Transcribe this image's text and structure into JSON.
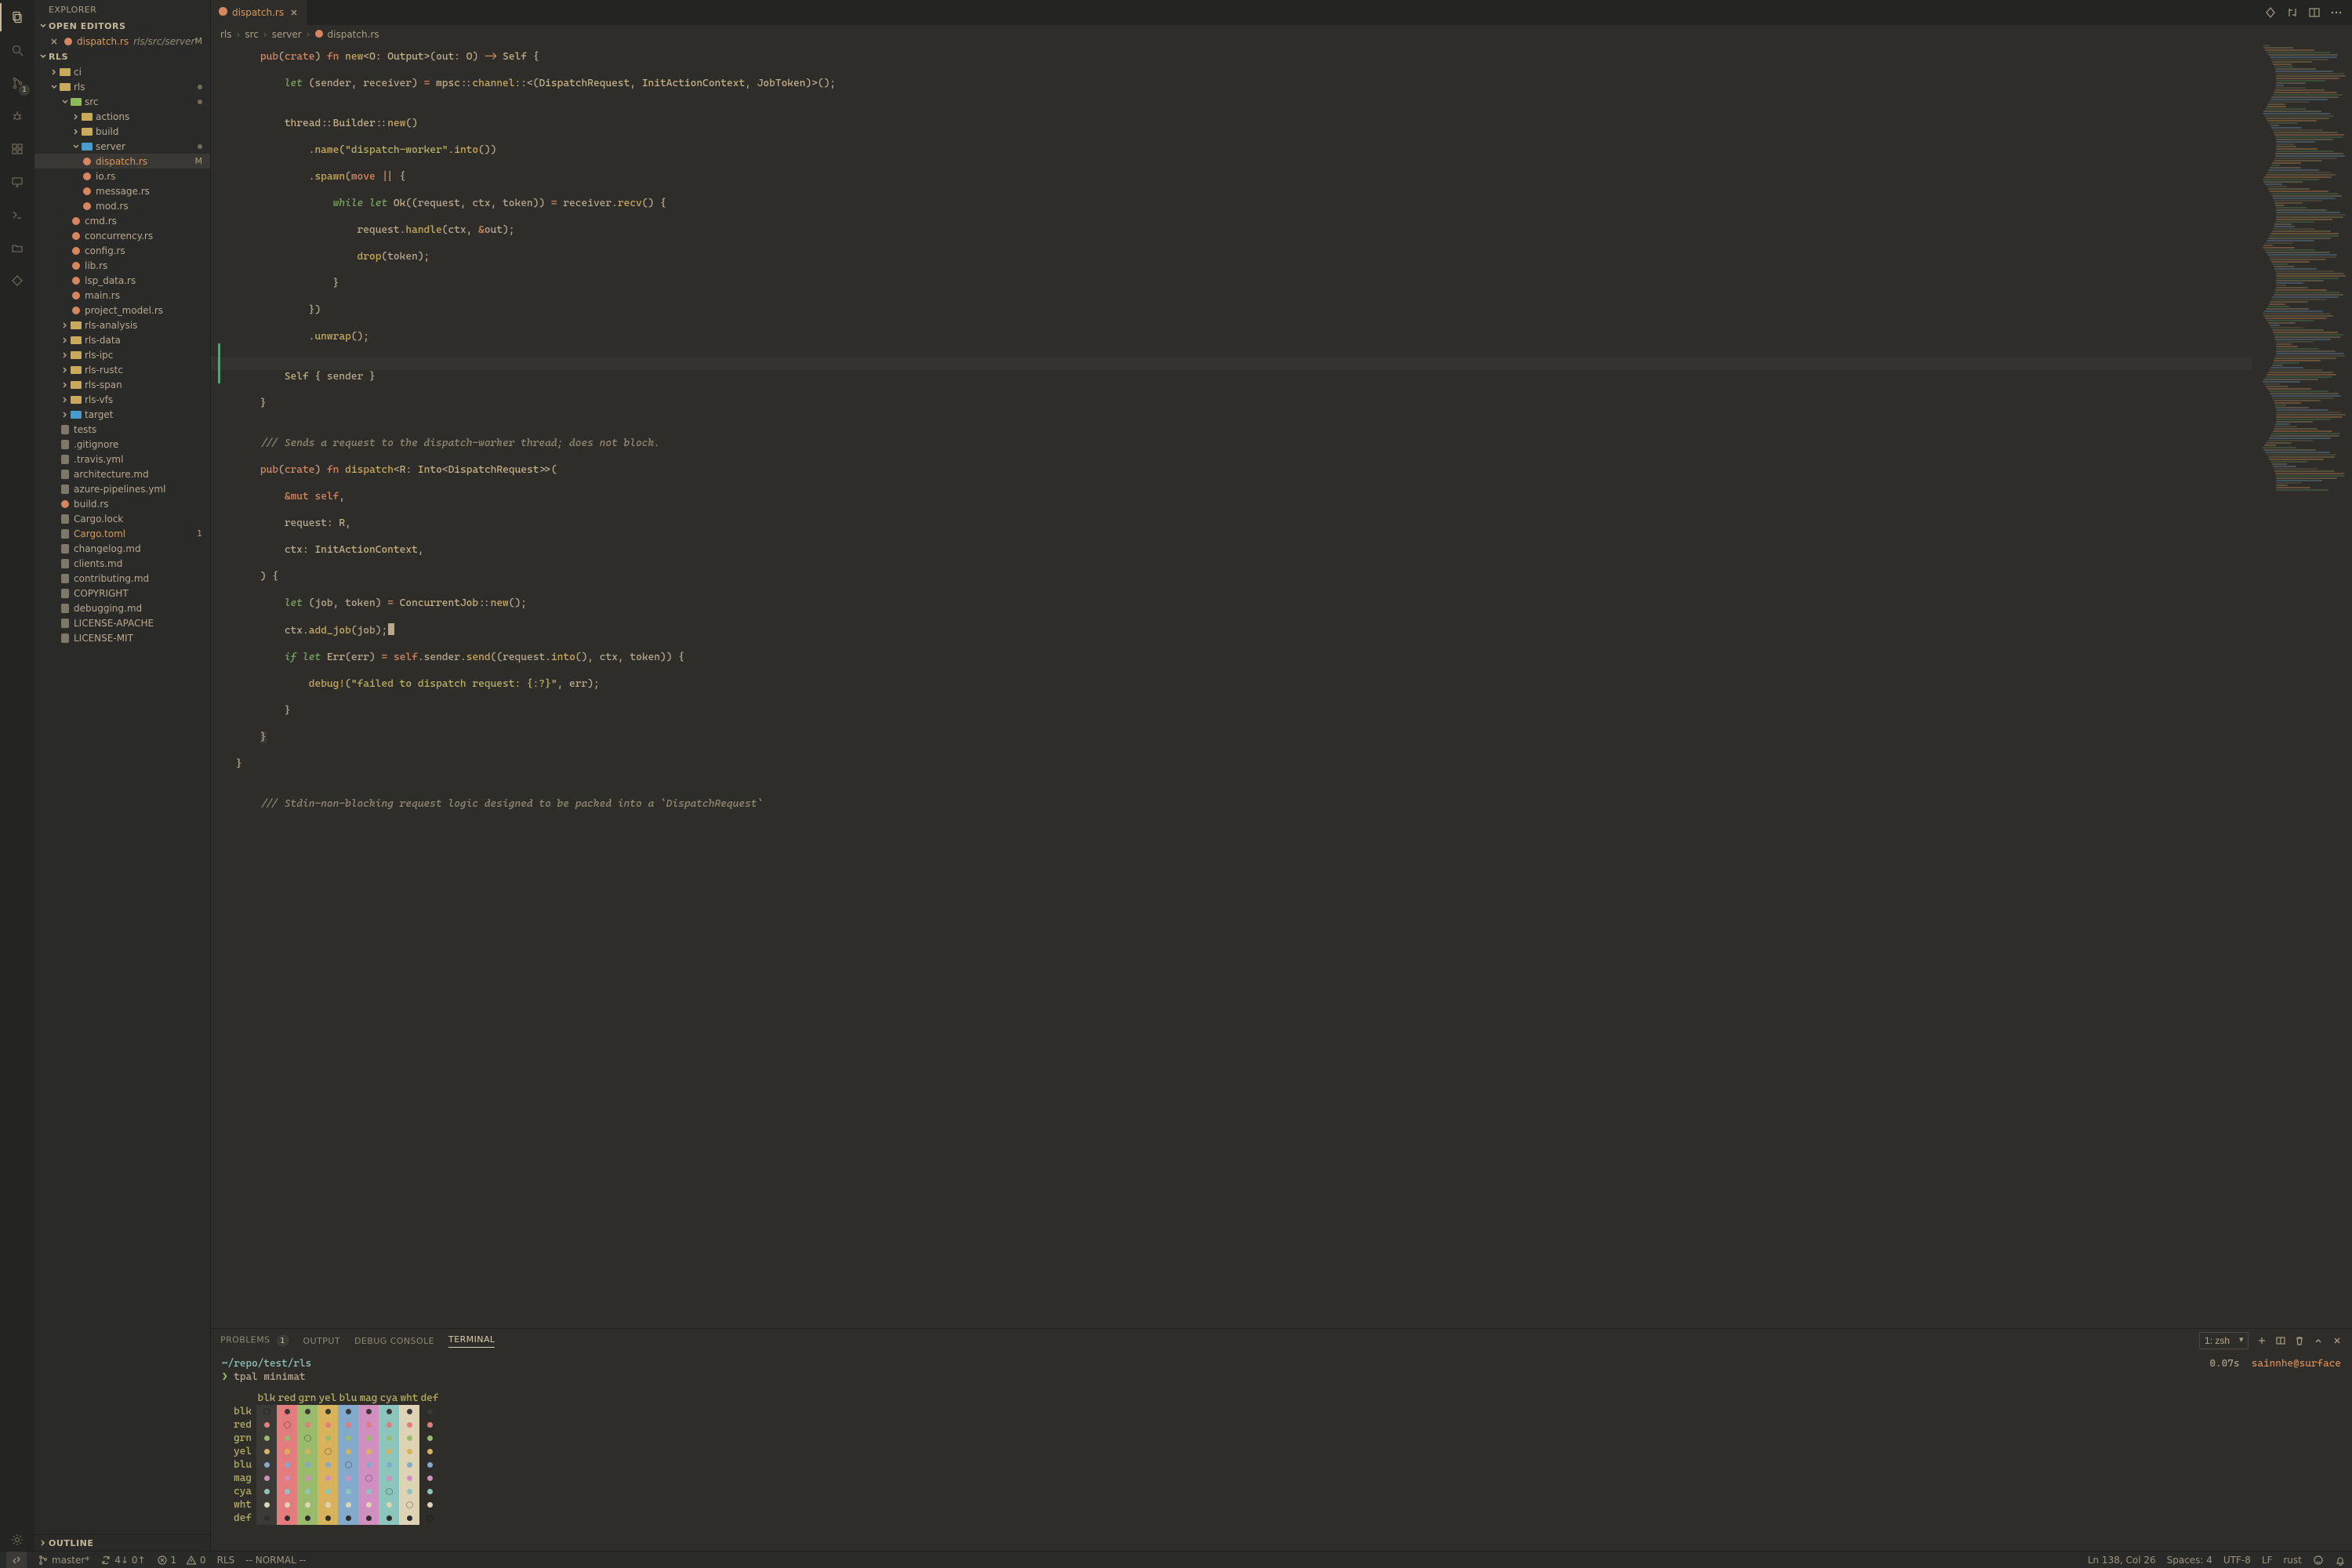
{
  "sidebar": {
    "title": "EXPLORER",
    "open_editors_label": "OPEN EDITORS",
    "open_editors": {
      "file_label": "dispatch.rs",
      "file_detail": "rls/src/server",
      "file_badge": "M"
    },
    "project_label": "RLS",
    "tree": [
      {
        "depth": 1,
        "type": "folder",
        "color": "",
        "chev": ">",
        "name": "ci"
      },
      {
        "depth": 1,
        "type": "folder",
        "color": "",
        "chev": "v",
        "name": "rls",
        "dot": true,
        "orange": false
      },
      {
        "depth": 2,
        "type": "folder",
        "color": "green",
        "chev": "v",
        "name": "src",
        "dot": true
      },
      {
        "depth": 3,
        "type": "folder",
        "color": "",
        "chev": ">",
        "name": "actions"
      },
      {
        "depth": 3,
        "type": "folder",
        "color": "",
        "chev": ">",
        "name": "build"
      },
      {
        "depth": 3,
        "type": "folder",
        "color": "blue",
        "chev": "v",
        "name": "server",
        "dot": true
      },
      {
        "depth": 4,
        "type": "rs",
        "name": "dispatch.rs",
        "active": true,
        "orange": true,
        "right": "M"
      },
      {
        "depth": 4,
        "type": "rs",
        "name": "io.rs"
      },
      {
        "depth": 4,
        "type": "rs",
        "name": "message.rs"
      },
      {
        "depth": 4,
        "type": "rs",
        "name": "mod.rs"
      },
      {
        "depth": 3,
        "type": "rs",
        "name": "cmd.rs"
      },
      {
        "depth": 3,
        "type": "rs",
        "name": "concurrency.rs"
      },
      {
        "depth": 3,
        "type": "rs",
        "name": "config.rs"
      },
      {
        "depth": 3,
        "type": "rs",
        "name": "lib.rs"
      },
      {
        "depth": 3,
        "type": "rs",
        "name": "lsp_data.rs"
      },
      {
        "depth": 3,
        "type": "rs",
        "name": "main.rs"
      },
      {
        "depth": 3,
        "type": "rs",
        "name": "project_model.rs"
      },
      {
        "depth": 2,
        "type": "folder",
        "color": "",
        "chev": ">",
        "name": "rls-analysis"
      },
      {
        "depth": 2,
        "type": "folder",
        "color": "",
        "chev": ">",
        "name": "rls-data"
      },
      {
        "depth": 2,
        "type": "folder",
        "color": "",
        "chev": ">",
        "name": "rls-ipc"
      },
      {
        "depth": 2,
        "type": "folder",
        "color": "",
        "chev": ">",
        "name": "rls-rustc"
      },
      {
        "depth": 2,
        "type": "folder",
        "color": "",
        "chev": ">",
        "name": "rls-span"
      },
      {
        "depth": 2,
        "type": "folder",
        "color": "",
        "chev": ">",
        "name": "rls-vfs"
      },
      {
        "depth": 2,
        "type": "folder",
        "color": "blue",
        "chev": ">",
        "name": "target"
      },
      {
        "depth": 2,
        "type": "file",
        "icon": "tests",
        "name": "tests"
      },
      {
        "depth": 2,
        "type": "file",
        "icon": "git",
        "name": ".gitignore"
      },
      {
        "depth": 2,
        "type": "file",
        "icon": "yml",
        "name": ".travis.yml"
      },
      {
        "depth": 2,
        "type": "file",
        "icon": "md",
        "name": "architecture.md"
      },
      {
        "depth": 2,
        "type": "file",
        "icon": "yml",
        "name": "azure-pipelines.yml"
      },
      {
        "depth": 2,
        "type": "rs",
        "name": "build.rs"
      },
      {
        "depth": 2,
        "type": "file",
        "icon": "cargo",
        "name": "Cargo.lock"
      },
      {
        "depth": 2,
        "type": "file",
        "icon": "cargo",
        "name": "Cargo.toml",
        "orange": true,
        "right": "1"
      },
      {
        "depth": 2,
        "type": "file",
        "icon": "md",
        "name": "changelog.md"
      },
      {
        "depth": 2,
        "type": "file",
        "icon": "md",
        "name": "clients.md"
      },
      {
        "depth": 2,
        "type": "file",
        "icon": "md",
        "name": "contributing.md"
      },
      {
        "depth": 2,
        "type": "file",
        "icon": "txt",
        "name": "COPYRIGHT"
      },
      {
        "depth": 2,
        "type": "file",
        "icon": "md",
        "name": "debugging.md"
      },
      {
        "depth": 2,
        "type": "file",
        "icon": "txt",
        "name": "LICENSE-APACHE"
      },
      {
        "depth": 2,
        "type": "file",
        "icon": "txt",
        "name": "LICENSE-MIT"
      }
    ],
    "outline_label": "OUTLINE"
  },
  "activity": {
    "scm_badge": "1"
  },
  "tab": {
    "label": "dispatch.rs"
  },
  "breadcrumb": {
    "p1": "rls",
    "p2": "src",
    "p3": "server",
    "p4": "dispatch.rs"
  },
  "panel": {
    "tabs": {
      "problems": "PROBLEMS",
      "problems_count": "1",
      "output": "OUTPUT",
      "debug": "DEBUG CONSOLE",
      "terminal": "TERMINAL"
    },
    "term_select": "1: zsh",
    "term": {
      "cwd": "~/repo/test/rls",
      "prompt_sym": "❯",
      "cmd": "tpal minimat",
      "rhs_time": "0.07s",
      "rhs_user": "sainnhe@surface"
    },
    "colors": {
      "labels": [
        "blk",
        "red",
        "grn",
        "yel",
        "blu",
        "mag",
        "cya",
        "wht",
        "def"
      ],
      "cols": [
        "#3b3a36",
        "#e37d7d",
        "#99bb6b",
        "#d8b35c",
        "#84aacb",
        "#d18fbf",
        "#8bc5bc",
        "#ded3b5",
        "#2e2d2a"
      ]
    }
  },
  "status": {
    "remote": "",
    "branch": "master*",
    "sync": "4↓ 0↑",
    "err": "1",
    "warn": "0",
    "rls": "RLS",
    "mode": "-- NORMAL --",
    "pos": "Ln 138, Col 26",
    "spaces": "Spaces: 4",
    "enc": "UTF-8",
    "eol": "LF",
    "lang": "rust"
  }
}
